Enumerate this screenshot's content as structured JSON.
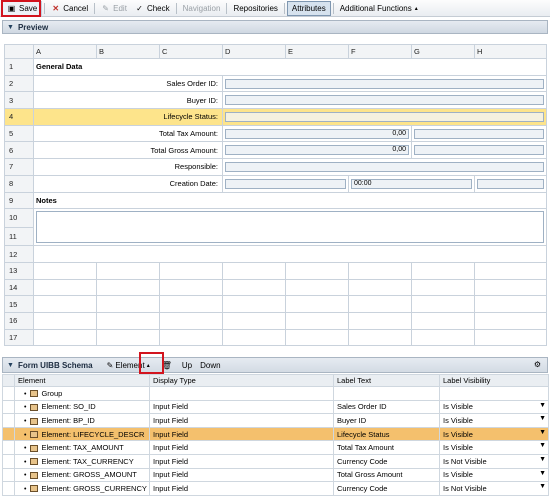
{
  "toolbar": {
    "save": "Save",
    "cancel": "Cancel",
    "edit": "Edit",
    "check": "Check",
    "navigation": "Navigation",
    "repositories": "Repositories",
    "attributes": "Attributes",
    "additional": "Additional Functions"
  },
  "preview": {
    "title": "Preview",
    "columns": [
      "A",
      "B",
      "C",
      "D",
      "E",
      "F",
      "G",
      "H"
    ],
    "rows": [
      {
        "n": "1",
        "label": "General Data"
      },
      {
        "n": "2",
        "label": "Sales Order ID:"
      },
      {
        "n": "3",
        "label": "Buyer ID:"
      },
      {
        "n": "4",
        "label": "Lifecycle Status:"
      },
      {
        "n": "5",
        "label": "Total Tax Amount:",
        "value": "0,00"
      },
      {
        "n": "6",
        "label": "Total Gross Amount:",
        "value": "0,00"
      },
      {
        "n": "7",
        "label": "Responsible:"
      },
      {
        "n": "8",
        "label": "Creation Date:",
        "time": "00:00"
      },
      {
        "n": "9",
        "label": "Notes"
      },
      {
        "n": "10"
      },
      {
        "n": "11"
      },
      {
        "n": "12"
      },
      {
        "n": "13"
      },
      {
        "n": "14"
      },
      {
        "n": "15"
      },
      {
        "n": "16"
      },
      {
        "n": "17"
      }
    ]
  },
  "schema": {
    "title": "Form UIBB Schema",
    "element": "Element",
    "up": "Up",
    "down": "Down",
    "headers": [
      "Element",
      "Display Type",
      "Label Text",
      "Label Visibility"
    ],
    "rows": [
      {
        "element": "Group",
        "display": "",
        "label": "",
        "visibility": "",
        "type": "group"
      },
      {
        "element": "Element: SO_ID",
        "display": "Input Field",
        "label": "Sales Order ID",
        "visibility": "Is Visible"
      },
      {
        "element": "Element: BP_ID",
        "display": "Input Field",
        "label": "Buyer ID",
        "visibility": "Is Visible"
      },
      {
        "element": "Element: LIFECYCLE_DESCR",
        "display": "Input Field",
        "label": "Lifecycle Status",
        "visibility": "Is Visible"
      },
      {
        "element": "Element: TAX_AMOUNT",
        "display": "Input Field",
        "label": "Total Tax Amount",
        "visibility": "Is Visible"
      },
      {
        "element": "Element: TAX_CURRENCY",
        "display": "Input Field",
        "label": "Currency Code",
        "visibility": "Is Not Visible"
      },
      {
        "element": "Element: GROSS_AMOUNT",
        "display": "Input Field",
        "label": "Total Gross Amount",
        "visibility": "Is Visible"
      },
      {
        "element": "Element: GROSS_CURRENCY",
        "display": "Input Field",
        "label": "Currency Code",
        "visibility": "Is Not Visible"
      }
    ]
  }
}
